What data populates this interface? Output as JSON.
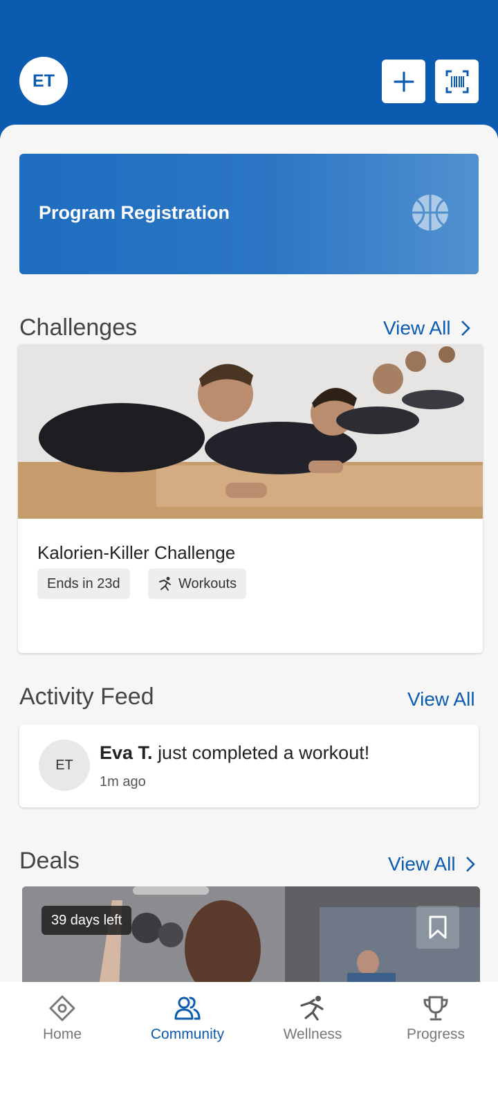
{
  "header": {
    "avatar_initials": "ET",
    "add_icon": "plus-icon",
    "scan_icon": "barcode-scan-icon",
    "bg_color": "#0b5bb0"
  },
  "banner": {
    "title": "Program Registration",
    "icon": "basketball-icon"
  },
  "challenges": {
    "title": "Challenges",
    "view_all": "View All",
    "card": {
      "title": "Kalorien-Killer Challenge",
      "tag_ends": "Ends in 23d",
      "tag_type": "Workouts",
      "tag_type_icon": "running-icon"
    }
  },
  "activity": {
    "title": "Activity Feed",
    "view_all": "View All",
    "item": {
      "avatar_initials": "ET",
      "name": "Eva T.",
      "text": "just completed a workout!",
      "time": "1m ago"
    }
  },
  "deals": {
    "title": "Deals",
    "view_all": "View All",
    "days_left": "39 days left",
    "bookmark_icon": "bookmark-icon"
  },
  "nav": {
    "items": [
      {
        "label": "Home",
        "icon": "home-icon",
        "active": false
      },
      {
        "label": "Community",
        "icon": "community-icon",
        "active": true
      },
      {
        "label": "Wellness",
        "icon": "wellness-icon",
        "active": false
      },
      {
        "label": "Progress",
        "icon": "trophy-icon",
        "active": false
      }
    ]
  }
}
